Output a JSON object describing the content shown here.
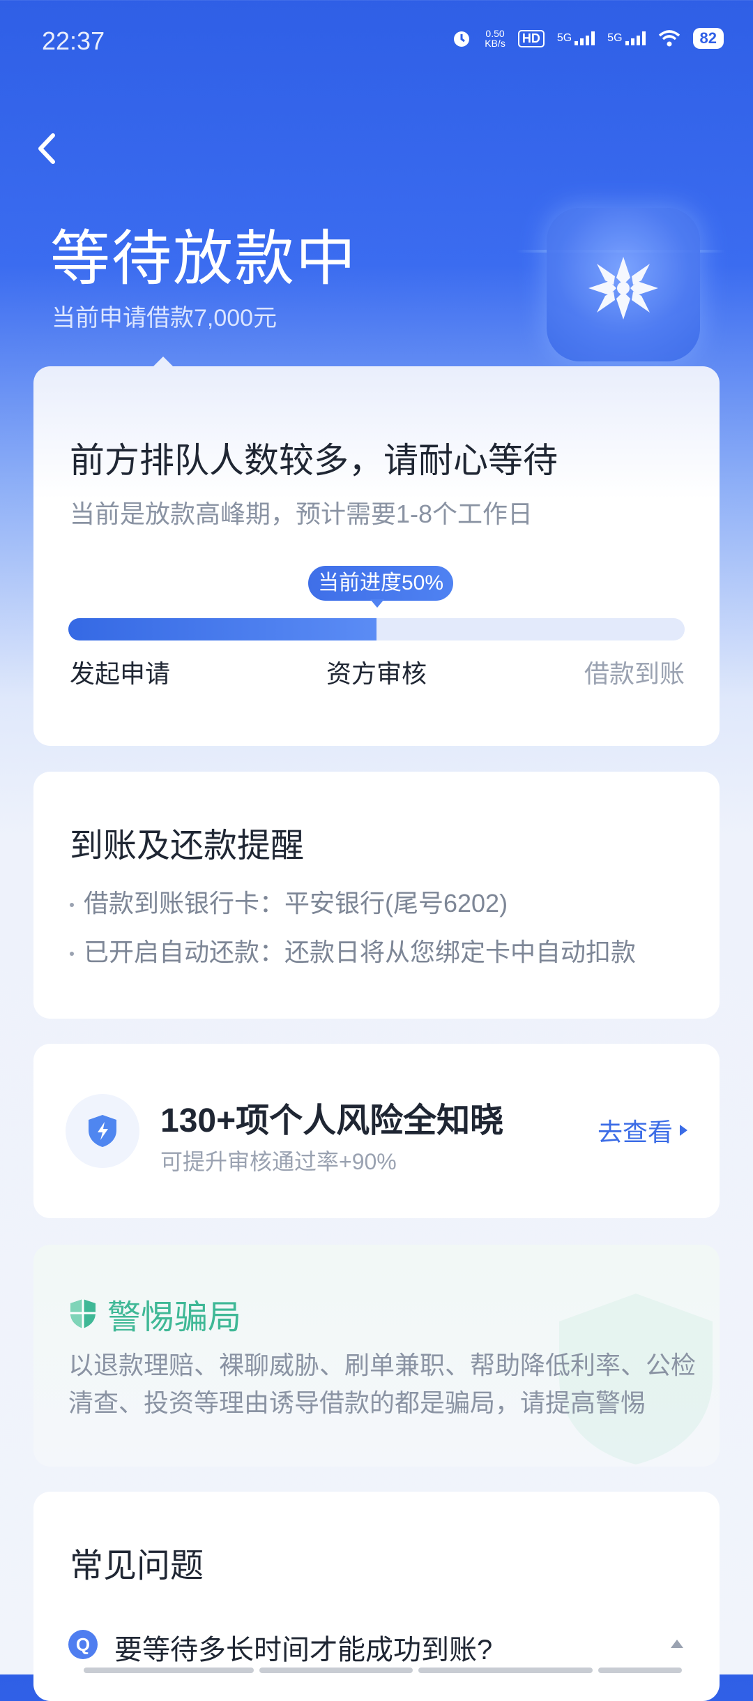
{
  "status_bar": {
    "time": "22:37",
    "net_speed": "0.50\nKB/s",
    "hd_label": "HD",
    "sim1_label": "5G",
    "sim2_label": "5G",
    "battery": "82"
  },
  "header": {
    "title": "等待放款中",
    "subtitle": "当前申请借款7,000元"
  },
  "progress_card": {
    "headline": "前方排队人数较多，请耐心等待",
    "description": "当前是放款高峰期，预计需要1-8个工作日",
    "progress_label": "当前进度50%",
    "progress": 0.5,
    "steps": [
      "发起申请",
      "资方审核",
      "借款到账"
    ]
  },
  "reminder_card": {
    "title": "到账及还款提醒",
    "items": [
      "借款到账银行卡：平安银行(尾号6202)",
      "已开启自动还款：还款日将从您绑定卡中自动扣款"
    ]
  },
  "risk_card": {
    "title": "130+项个人风险全知晓",
    "subtitle": "可提升审核通过率+90%",
    "link": "去查看"
  },
  "fraud_card": {
    "title": "警惕骗局",
    "text": "以退款理赔、裸聊威胁、刷单兼职、帮助降低利率、公检清查、投资等理由诱导借款的都是骗局，请提高警惕"
  },
  "faq_card": {
    "title": "常见问题",
    "badge": "Q",
    "question": "要等待多长时间才能成功到账?"
  },
  "colors": {
    "primary": "#3b6ce6",
    "fraud_green": "#3fb896",
    "muted": "#8a93a3"
  }
}
